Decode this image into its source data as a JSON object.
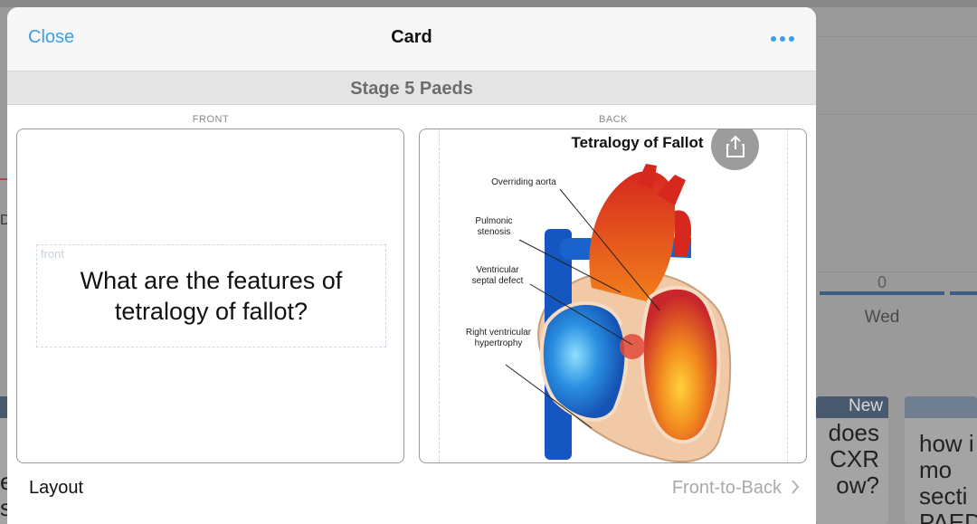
{
  "background": {
    "count": "0",
    "day": "Wed",
    "new_badge": "New",
    "card_a_text": "does\nCXR\now?",
    "card_b_text": "how i\nmo\nsecti\nPAEDS"
  },
  "navbar": {
    "close_label": "Close",
    "title": "Card",
    "more_icon": "ellipsis-icon"
  },
  "deck": {
    "name": "Stage 5 Paeds"
  },
  "front": {
    "section_label": "FRONT",
    "tag": "front",
    "question": "What are the features of tetralogy of fallot?"
  },
  "back": {
    "section_label": "BACK",
    "image_title": "Tetralogy of Fallot",
    "share_icon": "share-icon",
    "labels": {
      "overriding_aorta": "Overriding aorta",
      "pulmonic_stenosis": "Pulmonic\nstenosis",
      "vsd": "Ventricular\nseptal defect",
      "rvh": "Right ventricular\nhypertrophy"
    }
  },
  "layout": {
    "label": "Layout",
    "value": "Front-to-Back",
    "chevron_icon": "chevron-right-icon"
  },
  "colors": {
    "accent": "#3d9ee8",
    "deck_bar": "#e5e5e5",
    "dim_background": "#9a9a9a"
  }
}
